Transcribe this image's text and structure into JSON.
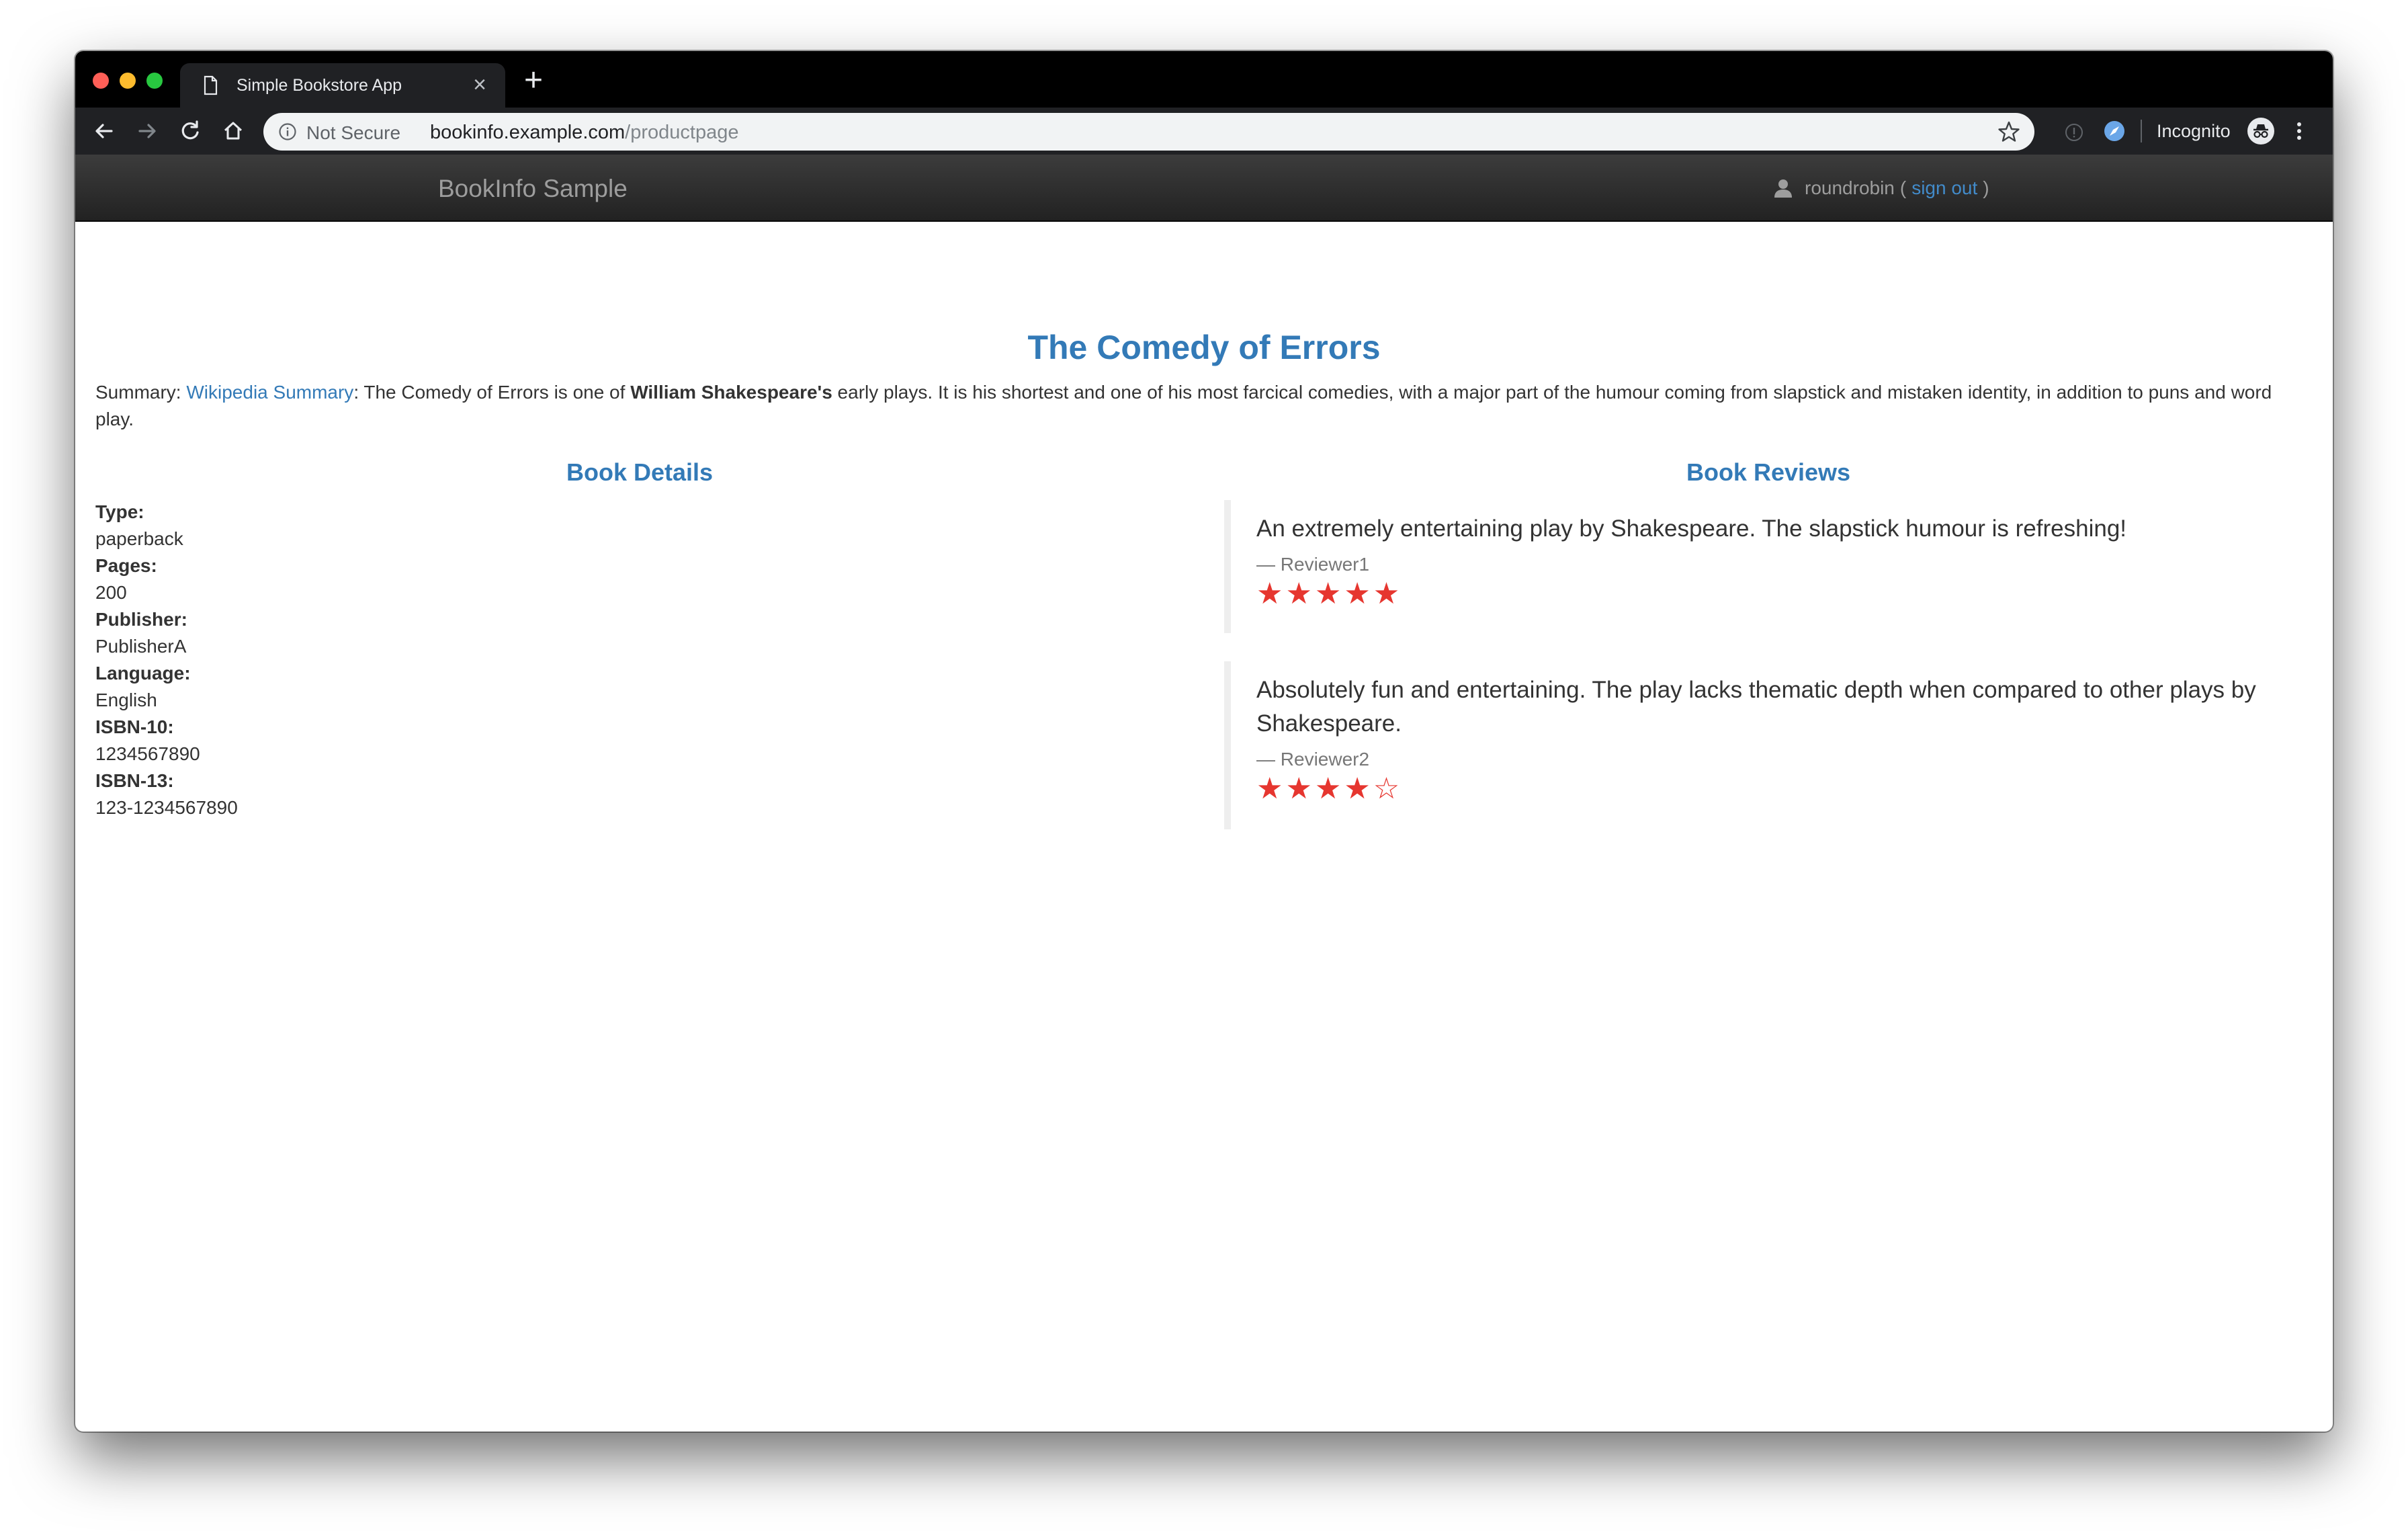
{
  "browser": {
    "tab_title": "Simple Bookstore App",
    "new_tab_label": "+",
    "close_glyph": "×",
    "security_label": "Not Secure",
    "url_host": "bookinfo.example.com",
    "url_path": "/productpage",
    "incognito_label": "Incognito"
  },
  "navbar": {
    "brand": "BookInfo Sample",
    "username": "roundrobin",
    "paren_open": "(",
    "sign_out": "sign out",
    "paren_close": ")"
  },
  "book": {
    "title": "The Comedy of Errors",
    "summary_prefix": "Summary: ",
    "summary_link": "Wikipedia Summary",
    "summary_part1": ": The Comedy of Errors is one of ",
    "summary_bold": "William Shakespeare's",
    "summary_part2": " early plays. It is his shortest and one of his most farcical comedies, with a major part of the humour coming from slapstick and mistaken identity, in addition to puns and word play."
  },
  "details": {
    "heading": "Book Details",
    "fields": [
      {
        "label": "Type:",
        "value": "paperback"
      },
      {
        "label": "Pages:",
        "value": "200"
      },
      {
        "label": "Publisher:",
        "value": "PublisherA"
      },
      {
        "label": "Language:",
        "value": "English"
      },
      {
        "label": "ISBN-10:",
        "value": "1234567890"
      },
      {
        "label": "ISBN-13:",
        "value": "123-1234567890"
      }
    ]
  },
  "reviews": {
    "heading": "Book Reviews",
    "items": [
      {
        "text": "An extremely entertaining play by Shakespeare. The slapstick humour is refreshing!",
        "reviewer": "— Reviewer1",
        "rating": 5,
        "stars": "★★★★★"
      },
      {
        "text": "Absolutely fun and entertaining. The play lacks thematic depth when compared to other plays by Shakespeare.",
        "reviewer": "— Reviewer2",
        "rating": 4,
        "stars": "★★★★☆"
      }
    ],
    "star_color": "#e6362f"
  },
  "colors": {
    "link": "#337ab7",
    "navbar": "#222222",
    "text": "#333333"
  }
}
